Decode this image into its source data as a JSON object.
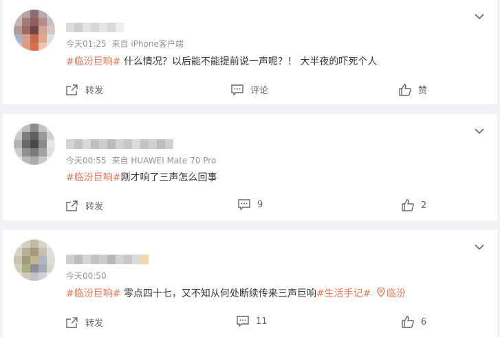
{
  "colors": {
    "tag": "#eb7350",
    "meta": "#939393",
    "text": "#333333",
    "bg": "#f1f2f5"
  },
  "comments": [
    {
      "time": "今天01:25",
      "source": "来自 iPhone客户端",
      "hashtag": "#临汾巨响#",
      "text": " 什么情况？以后能不能提前说一声呢？！  大半夜的吓死个人",
      "actions": {
        "forward": "转发",
        "comment": "评论",
        "like": "赞"
      }
    },
    {
      "time": "今天00:55",
      "source": "来自 HUAWEI Mate 70 Pro",
      "hashtag": "#临汾巨响#",
      "text": "刚才响了三声怎么回事",
      "actions": {
        "forward": "转发",
        "comment": "9",
        "like": "2"
      }
    },
    {
      "time": "今天00:50",
      "source": "",
      "hashtag": "#临汾巨响#",
      "text": " 零点四十七，又不知从何处断续传来三声巨响",
      "hashtag2": "#生活手记#",
      "location": "临汾",
      "actions": {
        "forward": "转发",
        "comment": "11",
        "like": "6"
      }
    }
  ],
  "icons": [
    "chevron-down-icon",
    "forward-icon",
    "comment-icon",
    "like-icon",
    "location-pin-icon"
  ]
}
